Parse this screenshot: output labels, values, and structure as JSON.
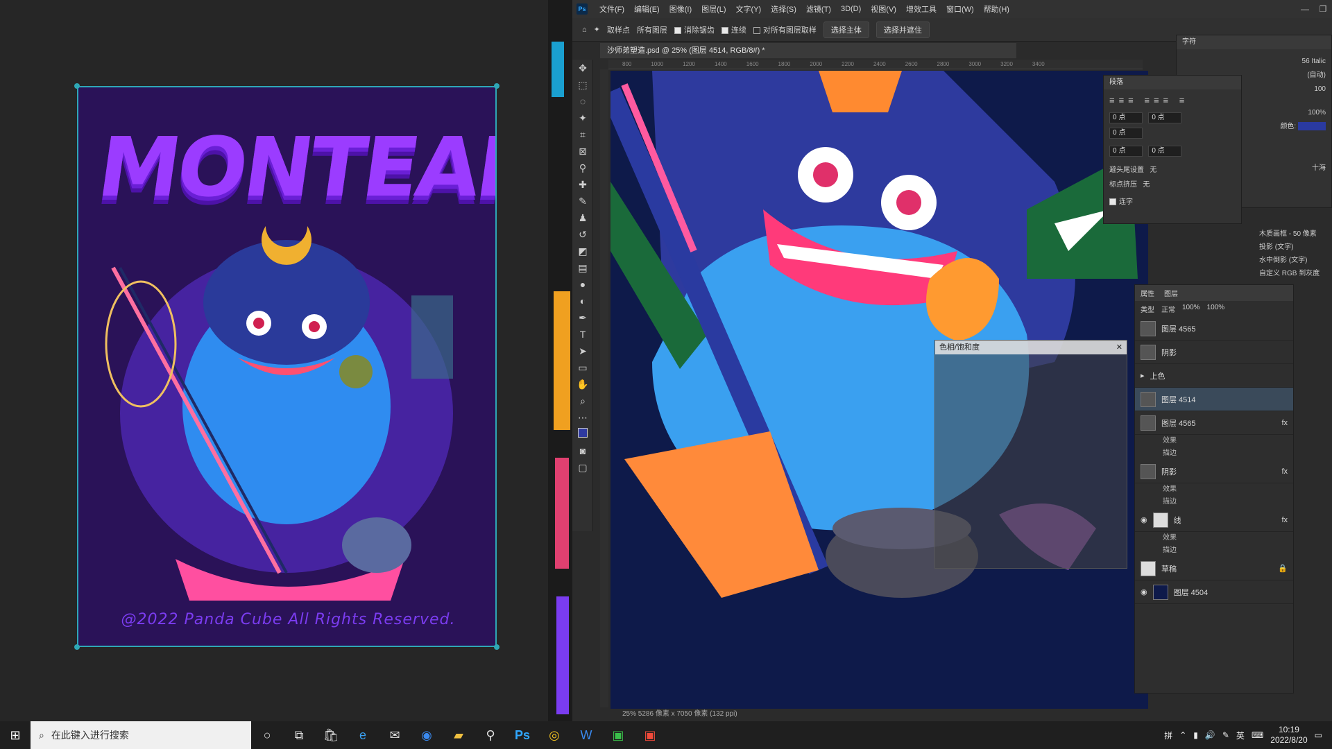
{
  "poster": {
    "title": "MONTEAND",
    "footer": "@2022 Panda Cube All Rights Reserved."
  },
  "photoshop": {
    "menu": [
      "文件(F)",
      "编辑(E)",
      "图像(I)",
      "图层(L)",
      "文字(Y)",
      "选择(S)",
      "滤镜(T)",
      "3D(D)",
      "视图(V)",
      "增效工具",
      "窗口(W)",
      "帮助(H)"
    ],
    "options": {
      "sample": "取样点",
      "all_layers": "所有图层",
      "anti_alias": "消除锯齿",
      "contiguous": "连续",
      "sample_all": "对所有图层取样",
      "select_subject": "选择主体",
      "select_mask": "选择并遮住"
    },
    "document_tab": "沙师弟塑造.psd @ 25% (图层 4514, RGB/8#) *",
    "ruler_ticks": [
      "800",
      "1000",
      "1200",
      "1400",
      "1600",
      "1800",
      "2000",
      "2200",
      "2400",
      "2600",
      "2800",
      "3000",
      "3200",
      "3400"
    ],
    "status": "25%   5286 像素 x 7050 像素 (132 ppi)",
    "character_panel": {
      "title": "字符",
      "font_style": "56 Italic",
      "leading": "(自动)",
      "tracking": "100",
      "scale": "100%",
      "color_label": "颜色:",
      "aa": "十海"
    },
    "paragraph_panel": {
      "title": "段落",
      "values": [
        "0 点",
        "0 点",
        "0 点",
        "0 点",
        "0 点"
      ],
      "hanging": "避头尾设置",
      "hanging_value": "无",
      "spacing": "标点挤压",
      "spacing_value": "无",
      "hyphenate": "连字"
    },
    "layer_effects": [
      "木质画框 - 50 像素",
      "投影 (文字)",
      "水中倒影 (文字)",
      "自定义 RGB 到灰度"
    ],
    "layers_panel": {
      "tabs": [
        "属性",
        "图层"
      ],
      "filter": "类型",
      "blend": "正常",
      "opacity": "100%",
      "fill": "100%",
      "layers": [
        {
          "name": "图层 4565"
        },
        {
          "name": "阴影"
        },
        {
          "name": "上色"
        },
        {
          "name": "图层 4514"
        },
        {
          "name": "图层 4565"
        },
        {
          "name": "效果"
        },
        {
          "name": "描边"
        },
        {
          "name": "阴影"
        },
        {
          "name": "效果"
        },
        {
          "name": "描边"
        },
        {
          "name": "线"
        },
        {
          "name": "效果"
        },
        {
          "name": "描边"
        },
        {
          "name": "草稿"
        },
        {
          "name": "图层 4504"
        }
      ]
    },
    "hue_dialog": "色相/饱和度"
  },
  "taskbar": {
    "search_placeholder": "在此键入进行搜索",
    "time": "10:19",
    "date": "2022/8/20",
    "ime": "英",
    "kbd": "拼"
  }
}
